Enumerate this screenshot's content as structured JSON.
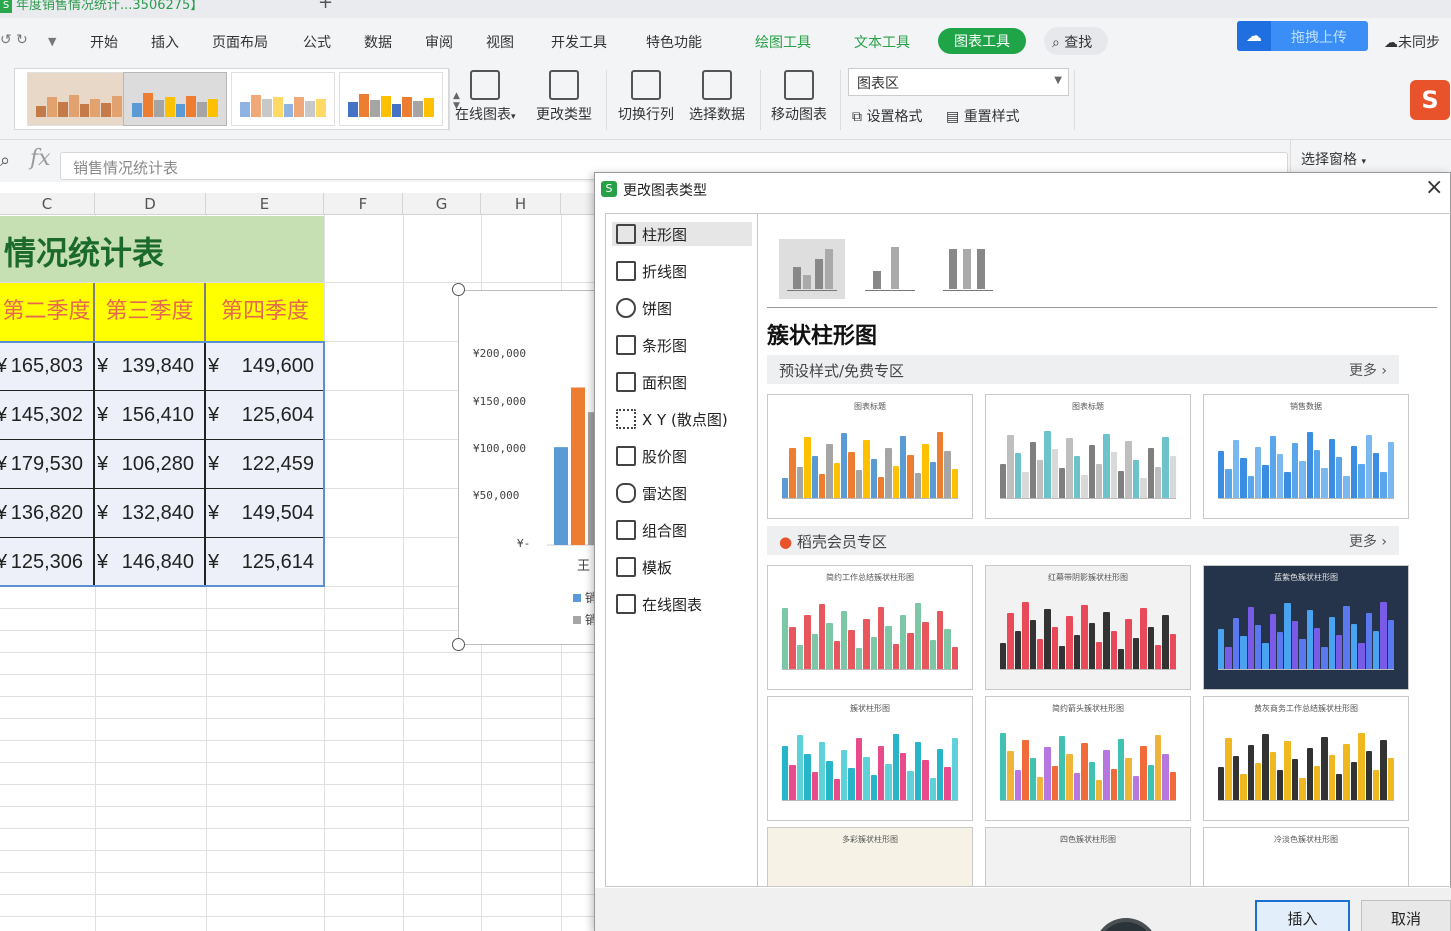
{
  "tabbar": {
    "doc_tab": "年度销售情况统计...3506275】"
  },
  "menubar": {
    "items": [
      "开始",
      "插入",
      "页面布局",
      "公式",
      "数据",
      "审阅",
      "视图",
      "开发工具",
      "特色功能"
    ],
    "tool_tabs": [
      "绘图工具",
      "文本工具",
      "图表工具"
    ],
    "search": "查找",
    "upload": "拖拽上传",
    "sync": "未同步"
  },
  "ribbon": {
    "online_chart": "在线图表",
    "change_type": "更改类型",
    "switch_rowcol": "切换行列",
    "select_data": "选择数据",
    "move_chart": "移动图表",
    "chart_area_value": "图表区",
    "set_format": "设置格式",
    "reset_style": "重置样式"
  },
  "formula": {
    "value": "销售情况统计表"
  },
  "select_pane": "选择窗格",
  "sheet": {
    "columns": [
      "C",
      "D",
      "E",
      "F",
      "G",
      "H"
    ],
    "title": "情况统计表",
    "headers": [
      "第二季度",
      "第三季度",
      "第四季度"
    ],
    "currency": "¥",
    "rows": [
      [
        "165,803",
        "139,840",
        "149,600"
      ],
      [
        "145,302",
        "156,410",
        "125,604"
      ],
      [
        "179,530",
        "106,280",
        "122,459"
      ],
      [
        "136,820",
        "132,840",
        "149,504"
      ],
      [
        "125,306",
        "146,840",
        "125,614"
      ]
    ]
  },
  "chart": {
    "yticks": [
      "¥200,000",
      "¥150,000",
      "¥100,000",
      "¥50,000",
      "¥-"
    ],
    "x_label_fragment": "王",
    "legend_fragment_1": "销",
    "legend_fragment_2": "销",
    "colors": {
      "blue": "#5b9bd5",
      "orange": "#ed7d31",
      "grey": "#a5a5a5"
    }
  },
  "chart_data": {
    "type": "bar",
    "categories": [
      "王"
    ],
    "series": [
      {
        "values": [
          103000
        ]
      },
      {
        "values": [
          165803
        ]
      },
      {
        "values": [
          139840
        ]
      }
    ],
    "ylim": [
      0,
      200000
    ],
    "yticks": [
      "¥200,000",
      "¥150,000",
      "¥100,000",
      "¥50,000",
      "¥-"
    ]
  },
  "dialog": {
    "title": "更改图表类型",
    "categories": [
      "柱形图",
      "折线图",
      "饼图",
      "条形图",
      "面积图",
      "X Y (散点图)",
      "股价图",
      "雷达图",
      "组合图",
      "模板",
      "在线图表"
    ],
    "selected_type": "簇状柱形图",
    "zone_free": "预设样式/免费专区",
    "zone_member": "稻壳会员专区",
    "more": "更多",
    "free_cards": [
      "图表标题",
      "图表标题",
      "销售数据"
    ],
    "member_cards": [
      "简约工作总结簇状柱形图",
      "红幕带阴影簇状柱形图",
      "蓝紫色簇状柱形图",
      "簇状柱形图",
      "简约箭头簇状柱形图",
      "黄灰商务工作总结簇状柱形图",
      "多彩簇状柱形图",
      "四色簇状柱形图",
      "冷淡色簇状柱形图"
    ],
    "insert": "插入",
    "cancel": "取消"
  }
}
